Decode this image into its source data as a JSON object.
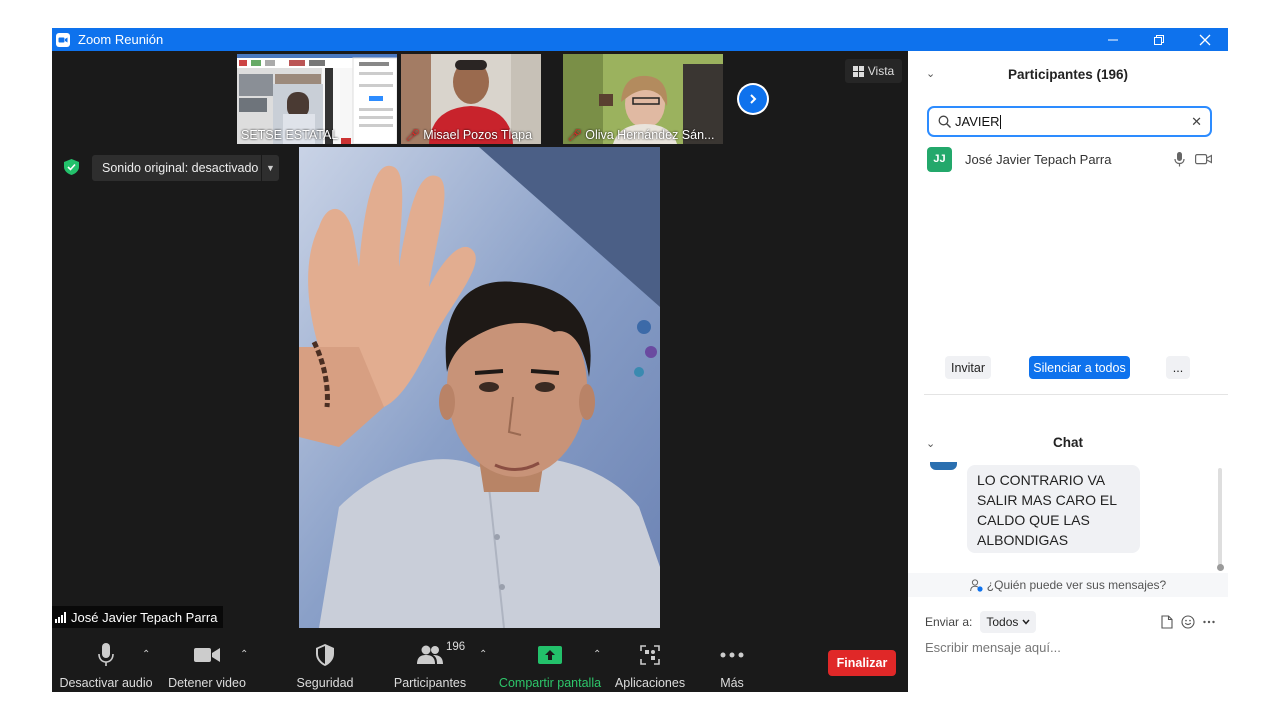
{
  "window": {
    "title": "Zoom Reunión"
  },
  "thumbnails": [
    {
      "name": "SETSE ESTATAL",
      "muted": false
    },
    {
      "name": "Misael Pozos Tlapa",
      "muted": true
    },
    {
      "name": "Oliva Hernández Sán...",
      "muted": true
    }
  ],
  "view_button": {
    "label": "Vista",
    "icon": "grid-icon"
  },
  "sound_pill": {
    "label": "Sonido original: desactivado"
  },
  "main_video": {
    "speaker_name": "José Javier Tepach Parra"
  },
  "toolbar": {
    "audio_label": "Desactivar audio",
    "video_label": "Detener video",
    "security_label": "Seguridad",
    "participants_label": "Participantes",
    "participants_count": "196",
    "share_label": "Compartir pantalla",
    "apps_label": "Aplicaciones",
    "more_label": "Más",
    "end_label": "Finalizar"
  },
  "participants_panel": {
    "title": "Participantes (196)",
    "search_value": "JAVIER",
    "results": [
      {
        "initials": "JJ",
        "name": "José Javier Tepach Parra",
        "avatar_color": "#23a86b"
      }
    ],
    "invite_label": "Invitar",
    "mute_all_label": "Silenciar a todos",
    "more_label": "..."
  },
  "chat_panel": {
    "title": "Chat",
    "message_lines": [
      "LO CONTRARIO VA",
      "SALIR MAS CARO EL",
      "CALDO QUE LAS",
      "ALBONDIGAS"
    ],
    "who_sees": "¿Quién puede ver sus mensajes?",
    "send_to_label": "Enviar a:",
    "send_to_value": "Todos",
    "input_placeholder": "Escribir mensaje aquí..."
  },
  "colors": {
    "accent": "#0e72ed",
    "danger": "#e02828",
    "share_green": "#2dc66a"
  }
}
